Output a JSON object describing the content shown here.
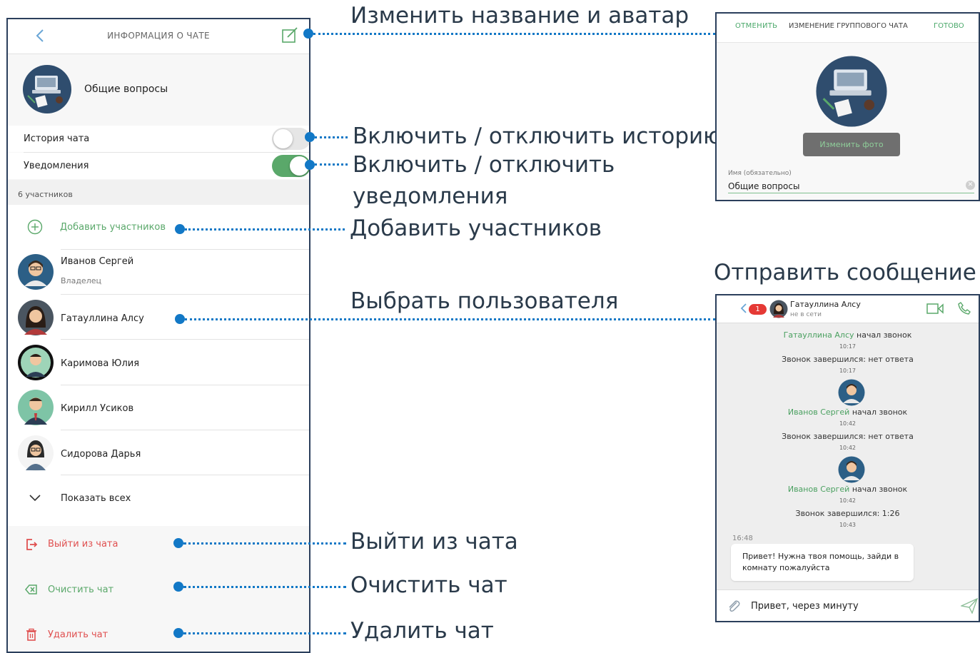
{
  "left_panel": {
    "header_title": "ИНФОРМАЦИЯ О ЧАТЕ",
    "chat_name": "Общие вопросы",
    "settings": [
      {
        "label": "История чата",
        "enabled": false
      },
      {
        "label": "Уведомления",
        "enabled": true
      }
    ],
    "participants_count": "6 участников",
    "add_participants": "Добавить участников",
    "members": [
      {
        "name": "Иванов Сергей",
        "role": "Владелец"
      },
      {
        "name": "Гатауллина Алсу",
        "role": ""
      },
      {
        "name": "Каримова Юлия",
        "role": ""
      },
      {
        "name": "Кирилл Усиков",
        "role": ""
      },
      {
        "name": "Сидорова Дарья",
        "role": ""
      }
    ],
    "show_all": "Показать всех",
    "actions": {
      "leave": "Выйти из чата",
      "clear": "Очистить чат",
      "delete": "Удалить чат"
    }
  },
  "callouts": {
    "edit": "Изменить название и аватар",
    "history": "Включить / отключить  историю",
    "notif_line1": "Включить / отключить",
    "notif_line2": "уведомления",
    "add": "Добавить участников",
    "select_user": "Выбрать пользователя",
    "send_message": "Отправить сообщение",
    "leave": "Выйти из чата",
    "clear": "Очистить чат",
    "delete": "Удалить чат"
  },
  "edit_panel": {
    "cancel": "ОТМЕНИТЬ",
    "title": "ИЗМЕНЕНИЕ ГРУППОВОГО ЧАТА",
    "done": "ГОТОВО",
    "change_photo": "Изменить фото",
    "field_label": "Имя (обязательно)",
    "field_value": "Общие вопросы"
  },
  "chat_panel": {
    "unread_badge": "1",
    "contact_name": "Гатауллина Алсу",
    "contact_status": "не в сети",
    "events": [
      {
        "actor": "Гатауллина Алсу",
        "text": " начал звонок",
        "time": "10:17"
      },
      {
        "actor": "",
        "text": "Звонок завершился: нет ответа",
        "time": "10:17"
      },
      {
        "actor": "Иванов Сергей",
        "text": " начал звонок",
        "time": "10:42"
      },
      {
        "actor": "",
        "text": "Звонок завершился: нет ответа",
        "time": "10:42"
      },
      {
        "actor": "Иванов Сергей",
        "text": " начал звонок",
        "time": "10:42"
      },
      {
        "actor": "",
        "text": "Звонок завершился: 1:26",
        "time": "10:43"
      }
    ],
    "message_time": "16:48",
    "message_text": "Привет! Нужна твоя помощь, зайди в комнату пожалуйста",
    "input_text": "Привет, через минуту"
  },
  "colors": {
    "accent_blue": "#1278c6",
    "green": "#5aa86a",
    "red": "#e05050",
    "border": "#2b3f5c"
  }
}
